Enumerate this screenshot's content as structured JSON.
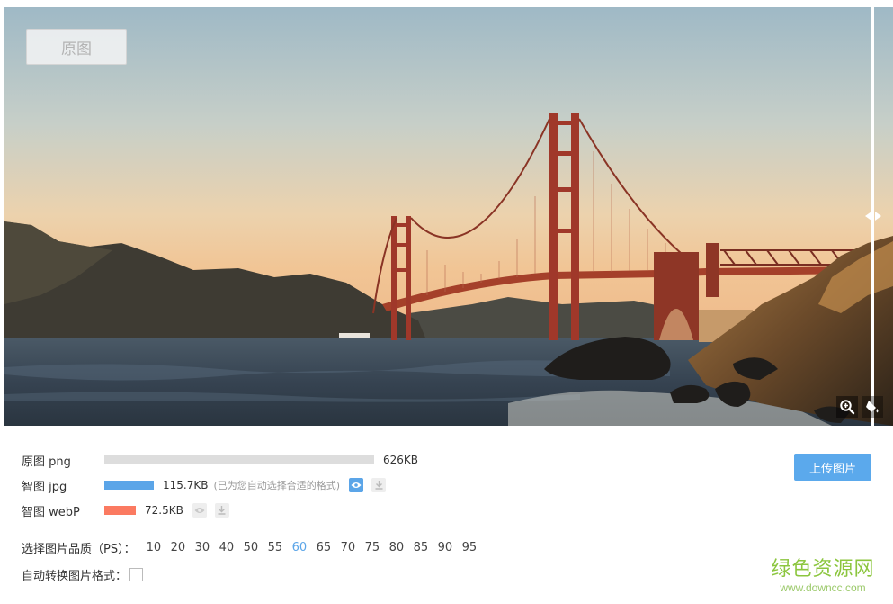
{
  "viewer": {
    "mode_label": "原图",
    "icons": {
      "split": "split-arrows-icon",
      "zoom": "zoom-in-icon",
      "drop": "color-drop-icon"
    }
  },
  "results": [
    {
      "name": "原图 png",
      "size": "626KB",
      "hint": "",
      "fraction": 1.0,
      "color": "#dddddd",
      "actions": []
    },
    {
      "name": "智图 jpg",
      "size": "115.7KB",
      "hint": "(已为您自动选择合适的格式)",
      "fraction": 0.1848,
      "color": "#5ba5e8",
      "actions": [
        "view-active",
        "download"
      ]
    },
    {
      "name": "智图 webP",
      "size": "72.5KB",
      "hint": "",
      "fraction": 0.1158,
      "color": "#fb7a61",
      "actions": [
        "view",
        "download"
      ]
    }
  ],
  "upload_label": "上传图片",
  "quality": {
    "label": "选择图片品质（PS）：",
    "options": [
      "10",
      "20",
      "30",
      "40",
      "50",
      "55",
      "60",
      "65",
      "70",
      "75",
      "80",
      "85",
      "90",
      "95"
    ],
    "selected": "60",
    "accent": "#5ba5e8"
  },
  "auto_convert": {
    "label": "自动转换图片格式：",
    "checked": false
  },
  "watermark": {
    "title": "绿色资源网",
    "url": "www.downcc.com",
    "color": "#8cc63f"
  }
}
